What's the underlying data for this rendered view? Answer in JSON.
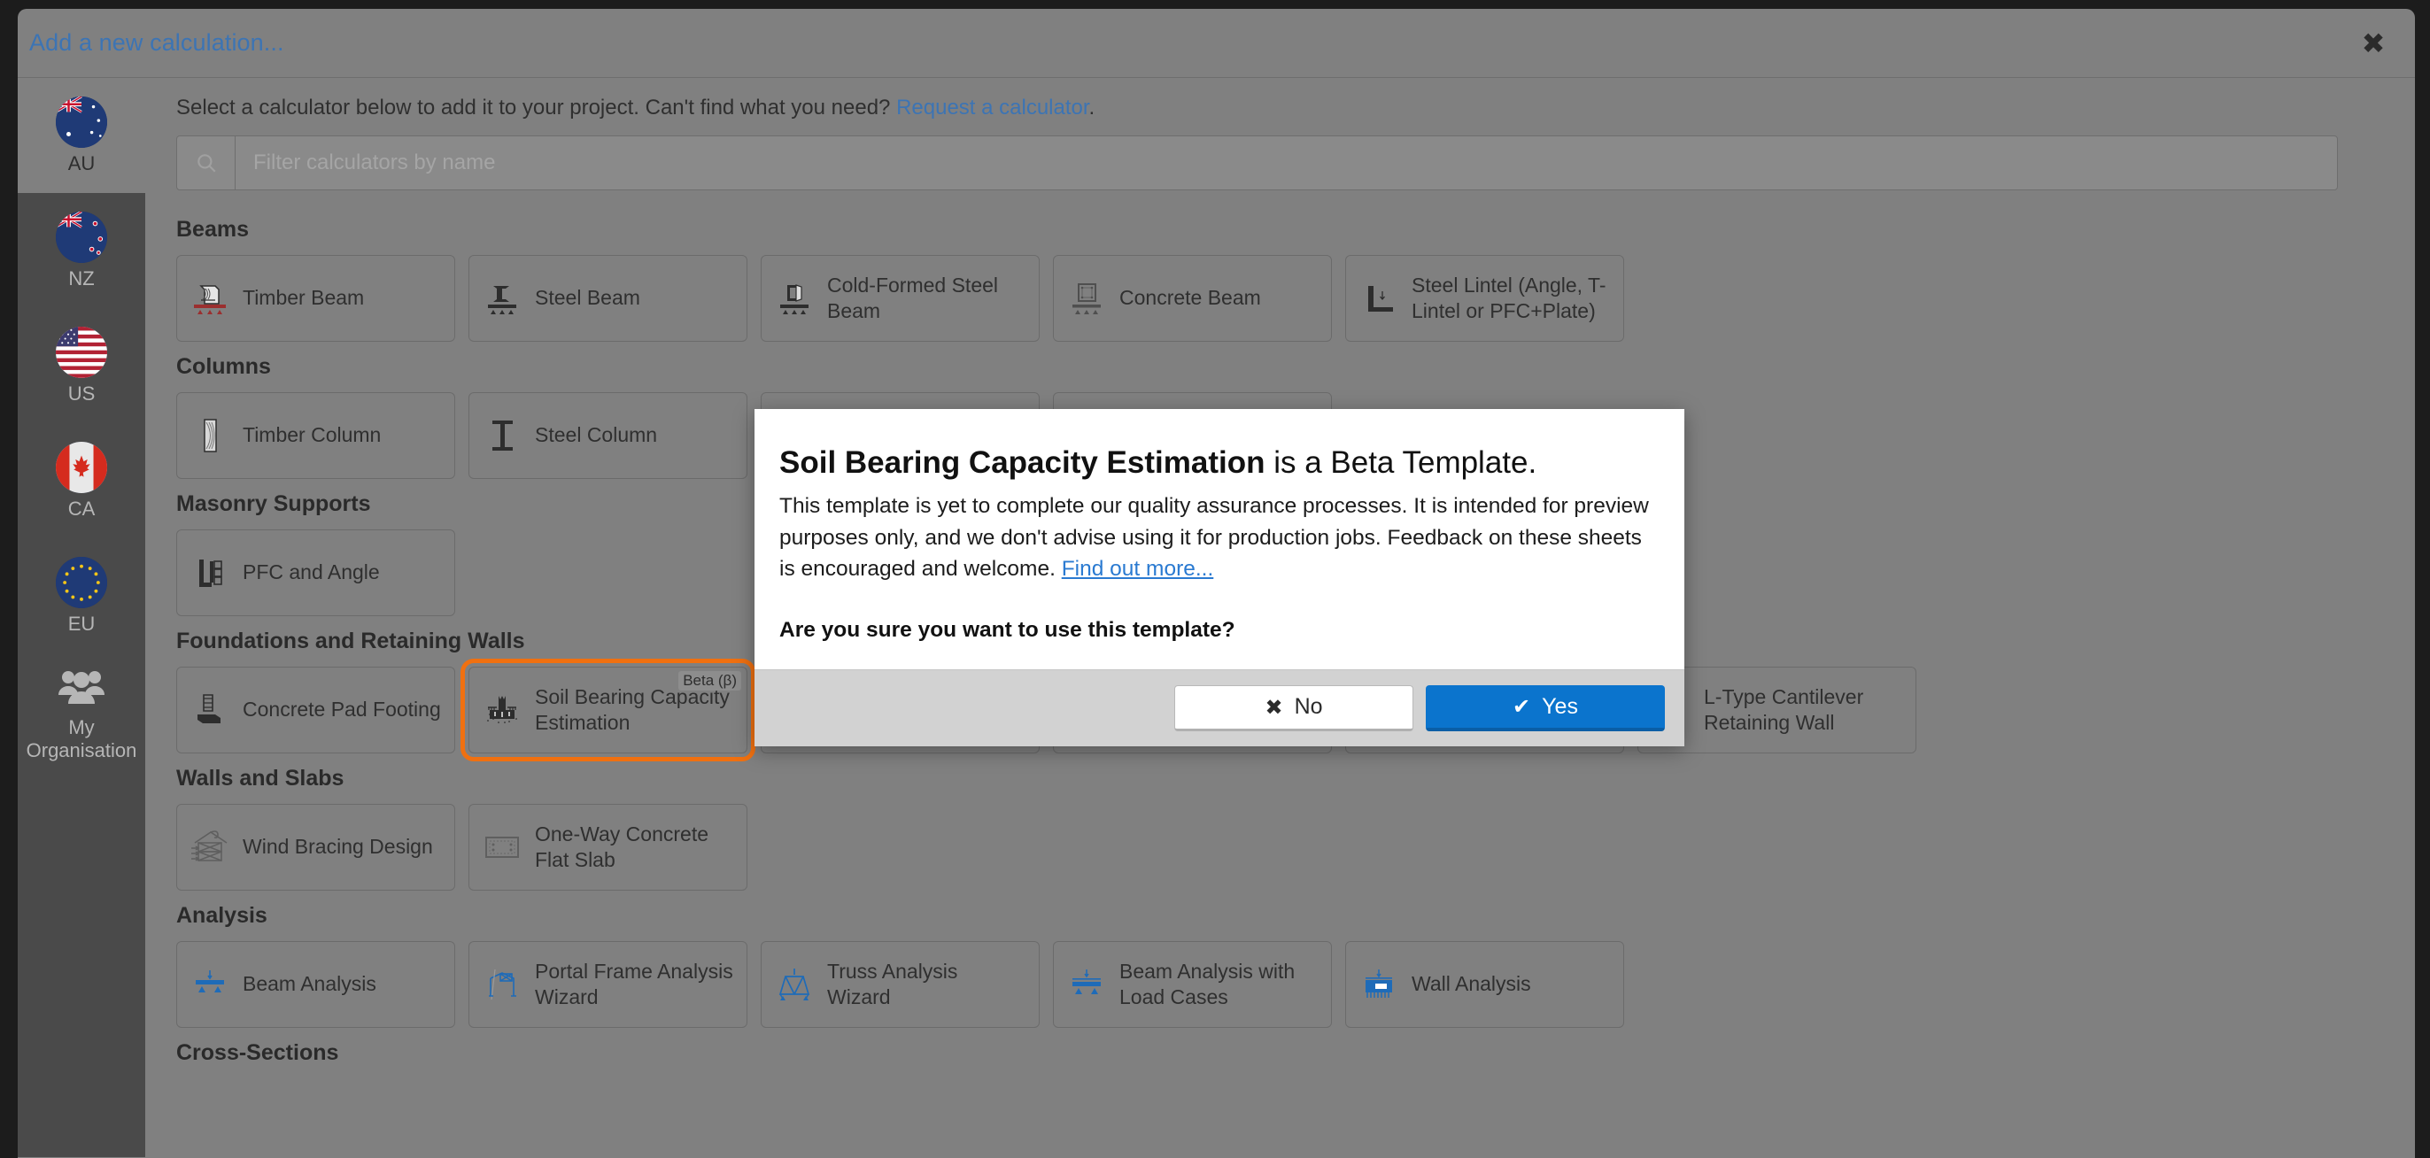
{
  "window": {
    "title": "Add a new calculation...",
    "close_icon": "close-icon"
  },
  "intro": {
    "text_before": "Select a calculator below to add it to your project. Can't find what you need? ",
    "link": "Request a calculator",
    "text_after": "."
  },
  "search": {
    "placeholder": "Filter calculators by name",
    "value": "",
    "icon": "search-icon"
  },
  "region_rail": {
    "items": [
      {
        "code": "AU",
        "label": "AU",
        "active": true
      },
      {
        "code": "NZ",
        "label": "NZ",
        "active": false
      },
      {
        "code": "US",
        "label": "US",
        "active": false
      },
      {
        "code": "CA",
        "label": "CA",
        "active": false
      },
      {
        "code": "EU",
        "label": "EU",
        "active": false
      },
      {
        "code": "ORG",
        "label": "My Organisation",
        "active": false
      }
    ]
  },
  "groups": [
    {
      "title": "Beams",
      "cards": [
        {
          "label": "Timber Beam",
          "icon": "timber-beam-icon",
          "beta": false
        },
        {
          "label": "Steel Beam",
          "icon": "steel-beam-icon",
          "beta": false
        },
        {
          "label": "Cold-Formed Steel Beam",
          "icon": "cold-formed-steel-beam-icon",
          "beta": false
        },
        {
          "label": "Concrete Beam",
          "icon": "concrete-beam-icon",
          "beta": false
        },
        {
          "label": "Steel Lintel (Angle, T-Lintel or PFC+Plate)",
          "icon": "steel-lintel-icon",
          "beta": false
        }
      ]
    },
    {
      "title": "Columns",
      "cards": [
        {
          "label": "Timber Column",
          "icon": "timber-column-icon",
          "beta": false
        },
        {
          "label": "Steel Column",
          "icon": "steel-column-icon",
          "beta": false
        },
        {
          "label": "",
          "icon": "hidden-icon",
          "beta": false
        },
        {
          "label": "",
          "icon": "hidden-icon",
          "beta": false
        }
      ]
    },
    {
      "title": "Masonry Supports",
      "cards": [
        {
          "label": "PFC and Angle",
          "icon": "pfc-and-angle-icon",
          "beta": false
        }
      ]
    },
    {
      "title": "Foundations and Retaining Walls",
      "cards": [
        {
          "label": "Concrete Pad Footing",
          "icon": "concrete-pad-footing-icon",
          "beta": false
        },
        {
          "label": "Soil Bearing Capacity Estimation",
          "icon": "soil-bearing-capacity-icon",
          "beta": true,
          "beta_label": "Beta (β)",
          "selected": true
        },
        {
          "label": "",
          "icon": "hidden-icon",
          "beta": false
        },
        {
          "label": "",
          "icon": "hidden-icon",
          "beta": false
        },
        {
          "label": "",
          "icon": "hidden-icon",
          "beta": false
        },
        {
          "label": "L-Type Cantilever Retaining Wall",
          "icon": "l-type-cantilever-retaining-wall-icon",
          "beta": false
        }
      ]
    },
    {
      "title": "Walls and Slabs",
      "cards": [
        {
          "label": "Wind Bracing Design",
          "icon": "wind-bracing-icon",
          "beta": false
        },
        {
          "label": "One-Way Concrete Flat Slab",
          "icon": "one-way-concrete-flat-slab-icon",
          "beta": false
        }
      ]
    },
    {
      "title": "Analysis",
      "accent": "#1e6bb8",
      "cards": [
        {
          "label": "Beam Analysis",
          "icon": "beam-analysis-icon",
          "beta": false
        },
        {
          "label": "Portal Frame Analysis Wizard",
          "icon": "portal-frame-analysis-icon",
          "beta": false
        },
        {
          "label": "Truss Analysis Wizard",
          "icon": "truss-analysis-icon",
          "beta": false
        },
        {
          "label": "Beam Analysis with Load Cases",
          "icon": "beam-analysis-load-cases-icon",
          "beta": false
        },
        {
          "label": "Wall Analysis",
          "icon": "wall-analysis-icon",
          "beta": false
        }
      ]
    },
    {
      "title": "Cross-Sections",
      "cards": []
    }
  ],
  "modal": {
    "title_bold": "Soil Bearing Capacity Estimation",
    "title_rest": " is a Beta Template.",
    "body_text": "This template is yet to complete our quality assurance processes. It is intended for preview purposes only, and we don't advise using it for production jobs. Feedback on these sheets is encouraged and welcome. ",
    "body_link": "Find out more...",
    "question": "Are you sure you want to use this template?",
    "buttons": {
      "no_label": "No",
      "no_icon": "cross-icon",
      "yes_label": "Yes",
      "yes_icon": "check-icon"
    },
    "colors": {
      "primary": "#0b74cd",
      "link": "#2a7ad1"
    }
  }
}
